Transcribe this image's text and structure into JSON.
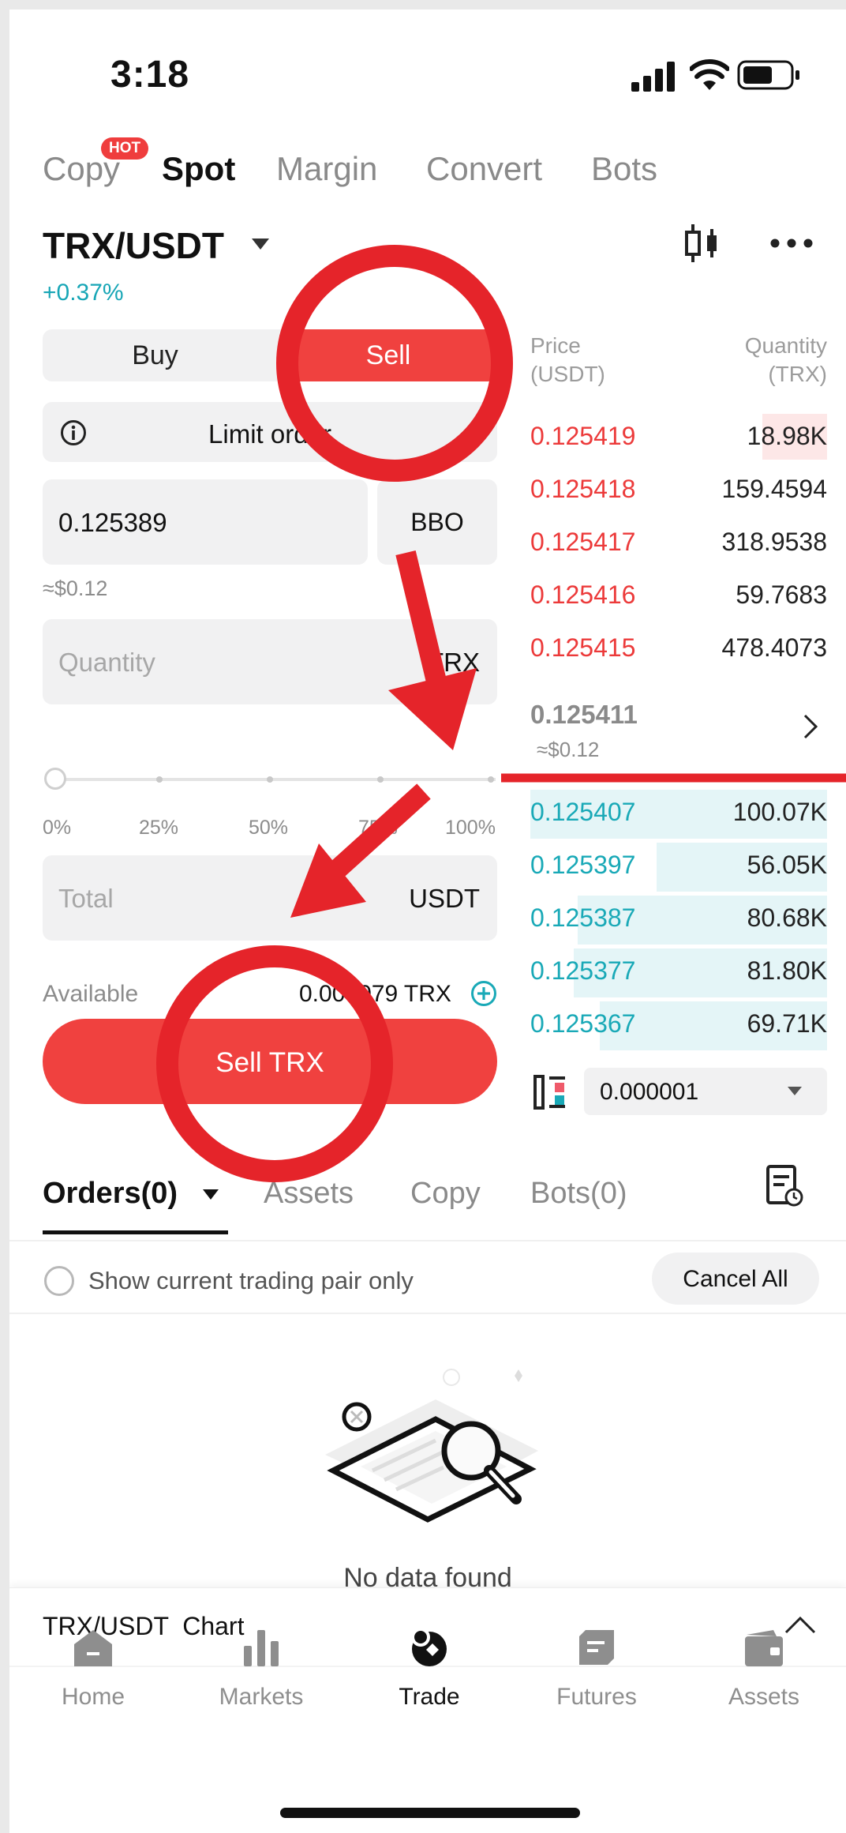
{
  "status": {
    "time": "3:18"
  },
  "top_tabs": [
    {
      "label": "Copy",
      "active": false
    },
    {
      "label": "Spot",
      "active": true
    },
    {
      "label": "Margin",
      "active": false
    },
    {
      "label": "Convert",
      "active": false
    },
    {
      "label": "Bots",
      "active": false
    }
  ],
  "hot_badge": "HOT",
  "pair": {
    "name": "TRX/USDT",
    "change": "+0.37%"
  },
  "side": {
    "buy": "Buy",
    "sell": "Sell"
  },
  "order_type": "Limit order",
  "price": {
    "value": "0.125389",
    "bbo_label": "BBO",
    "approx": "≈$0.12"
  },
  "quantity": {
    "placeholder": "Quantity",
    "unit": "TRX"
  },
  "slider": {
    "labels": [
      "0%",
      "25%",
      "50%",
      "75%",
      "100%"
    ],
    "value_percent": 0
  },
  "total": {
    "placeholder": "Total",
    "unit": "USDT"
  },
  "available": {
    "label": "Available",
    "value": "0.000079 TRX"
  },
  "sell_button": "Sell TRX",
  "orderbook": {
    "price_header": "Price",
    "price_unit": "(USDT)",
    "qty_header": "Quantity",
    "qty_unit": "(TRX)",
    "asks": [
      {
        "price": "0.125419",
        "qty": "18.98K"
      },
      {
        "price": "0.125418",
        "qty": "159.4594"
      },
      {
        "price": "0.125417",
        "qty": "318.9538"
      },
      {
        "price": "0.125416",
        "qty": "59.7683"
      },
      {
        "price": "0.125415",
        "qty": "478.4073"
      }
    ],
    "mid": {
      "price": "0.125411",
      "approx": "≈$0.12"
    },
    "bids": [
      {
        "price": "0.125407",
        "qty": "100.07K"
      },
      {
        "price": "0.125397",
        "qty": "56.05K"
      },
      {
        "price": "0.125387",
        "qty": "80.68K"
      },
      {
        "price": "0.125377",
        "qty": "81.80K"
      },
      {
        "price": "0.125367",
        "qty": "69.71K"
      }
    ],
    "precision": "0.000001"
  },
  "bottom_tabs": [
    {
      "label": "Orders(0)",
      "active": true
    },
    {
      "label": "Assets",
      "active": false
    },
    {
      "label": "Copy",
      "active": false
    },
    {
      "label": "Bots(0)",
      "active": false
    }
  ],
  "show_current_pair": "Show current trading pair only",
  "cancel_all": "Cancel All",
  "empty_state": "No data found",
  "chart_bar": {
    "label": "TRX/USDT  Chart"
  },
  "bottom_nav": [
    {
      "label": "Home",
      "icon": "home-icon",
      "active": false
    },
    {
      "label": "Markets",
      "icon": "markets-icon",
      "active": false
    },
    {
      "label": "Trade",
      "icon": "trade-icon",
      "active": true
    },
    {
      "label": "Futures",
      "icon": "futures-icon",
      "active": false
    },
    {
      "label": "Assets",
      "icon": "assets-icon",
      "active": false
    }
  ],
  "colors": {
    "sell": "#f0413f",
    "teal": "#19a9b7",
    "annotation": "#e5242a"
  }
}
